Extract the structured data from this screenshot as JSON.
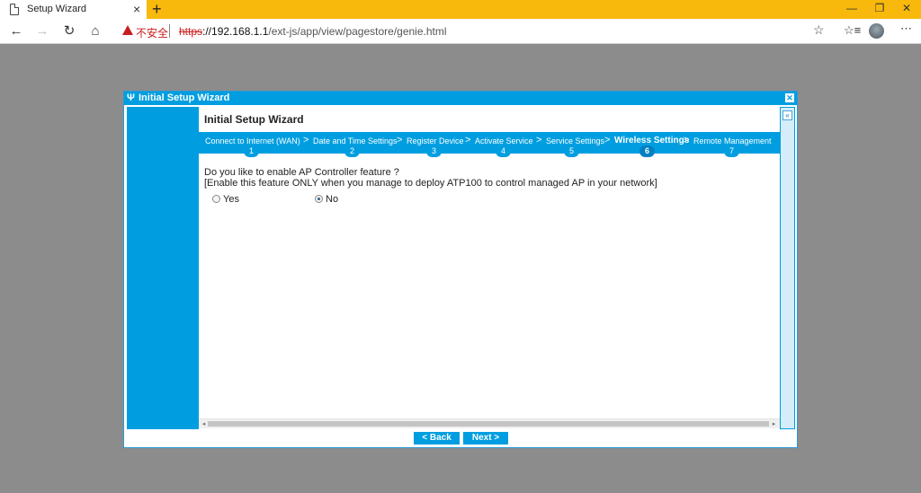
{
  "browser": {
    "tab_title": "Setup Wizard",
    "tab_close": "×",
    "new_tab": "+",
    "window_controls": {
      "minimize": "—",
      "maximize": "❐",
      "close": "✕"
    },
    "nav": {
      "back": "←",
      "forward": "→",
      "refresh": "↻",
      "home": "⌂"
    },
    "security_warning": "不安全",
    "url_protocol": "https",
    "url_host": "://192.168.1.1",
    "url_path": "/ext-js/app/view/pagestore/genie.html",
    "icons": {
      "favorite": "star-icon",
      "favorites_bar": "favorites-icon",
      "profile": "avatar"
    }
  },
  "dialog": {
    "header_title": "Initial Setup Wizard",
    "header_icon": "settings-icon",
    "close": "✕",
    "collapse": "«",
    "wizard_title": "Initial Setup Wizard",
    "steps": [
      {
        "label": "Connect to Internet (WAN)",
        "number": "1"
      },
      {
        "label": "Date and Time Settings",
        "number": "2"
      },
      {
        "label": "Register Device",
        "number": "3"
      },
      {
        "label": "Activate Service",
        "number": "4"
      },
      {
        "label": "Service Settings",
        "number": "5"
      },
      {
        "label": "Wireless Settings",
        "number": "6",
        "active": true
      },
      {
        "label": "Remote Management",
        "number": "7"
      }
    ],
    "step_separator": ">",
    "question": "Do you like to enable AP Controller feature ?",
    "note": "[Enable this feature ONLY when you manage to deploy ATP100 to control managed AP in your network]",
    "options": [
      {
        "label": "Yes",
        "checked": false
      },
      {
        "label": "No",
        "checked": true
      }
    ],
    "scroll_left": "◂",
    "scroll_right": "▸",
    "buttons": {
      "back": "< Back",
      "next": "Next >"
    },
    "colors": {
      "accent": "#009ee0",
      "background": "#8c8c8c",
      "tabbar": "#f8b90c"
    }
  }
}
